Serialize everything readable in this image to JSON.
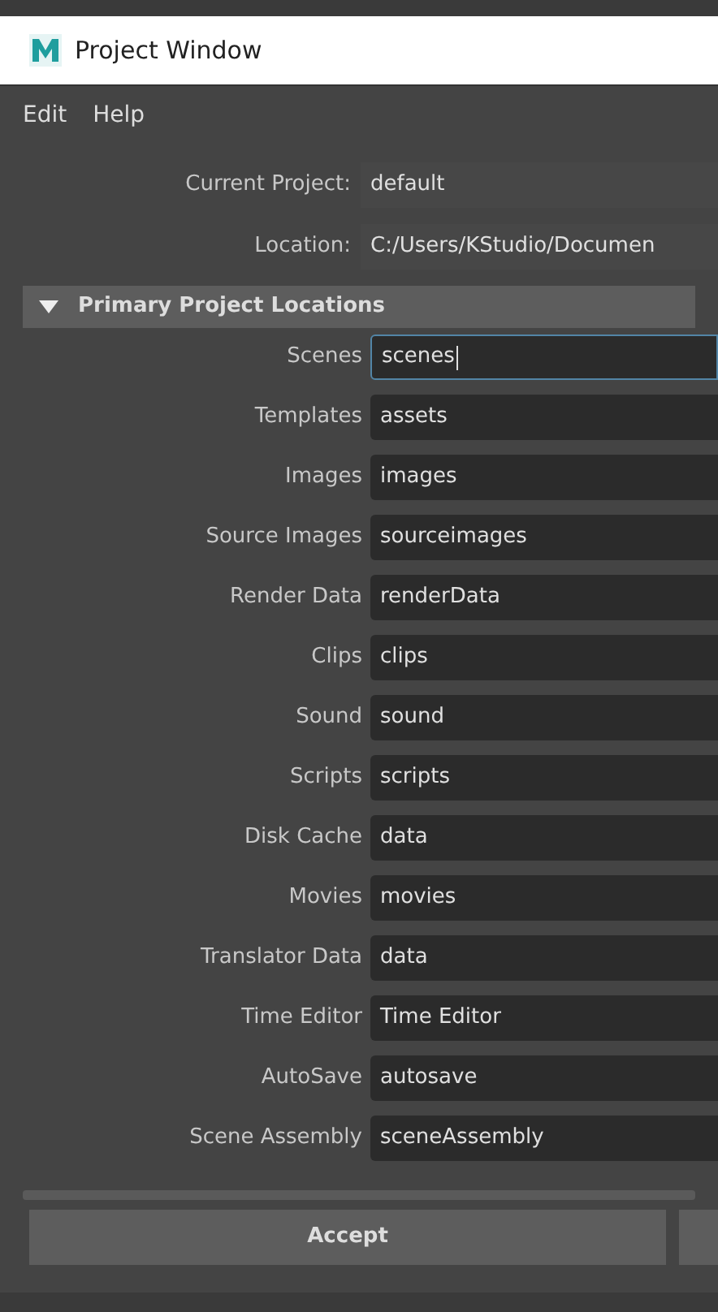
{
  "window": {
    "title": "Project Window"
  },
  "menu": [
    "Edit",
    "Help"
  ],
  "info": [
    {
      "label": "Current Project:",
      "value": "default"
    },
    {
      "label": "Location:",
      "value": "C:/Users/KStudio/Documen"
    }
  ],
  "section": {
    "title": "Primary Project Locations",
    "expanded": true
  },
  "locations": [
    {
      "label": "Scenes",
      "value": "scenes",
      "focused": true
    },
    {
      "label": "Templates",
      "value": "assets",
      "focused": false
    },
    {
      "label": "Images",
      "value": "images",
      "focused": false
    },
    {
      "label": "Source Images",
      "value": "sourceimages",
      "focused": false
    },
    {
      "label": "Render Data",
      "value": "renderData",
      "focused": false
    },
    {
      "label": "Clips",
      "value": "clips",
      "focused": false
    },
    {
      "label": "Sound",
      "value": "sound",
      "focused": false
    },
    {
      "label": "Scripts",
      "value": "scripts",
      "focused": false
    },
    {
      "label": "Disk Cache",
      "value": "data",
      "focused": false
    },
    {
      "label": "Movies",
      "value": "movies",
      "focused": false
    },
    {
      "label": "Translator Data",
      "value": "data",
      "focused": false
    },
    {
      "label": "Time Editor",
      "value": "Time Editor",
      "focused": false
    },
    {
      "label": "AutoSave",
      "value": "autosave",
      "focused": false
    },
    {
      "label": "Scene Assembly",
      "value": "sceneAssembly",
      "focused": false
    }
  ],
  "buttons": [
    "Accept"
  ]
}
